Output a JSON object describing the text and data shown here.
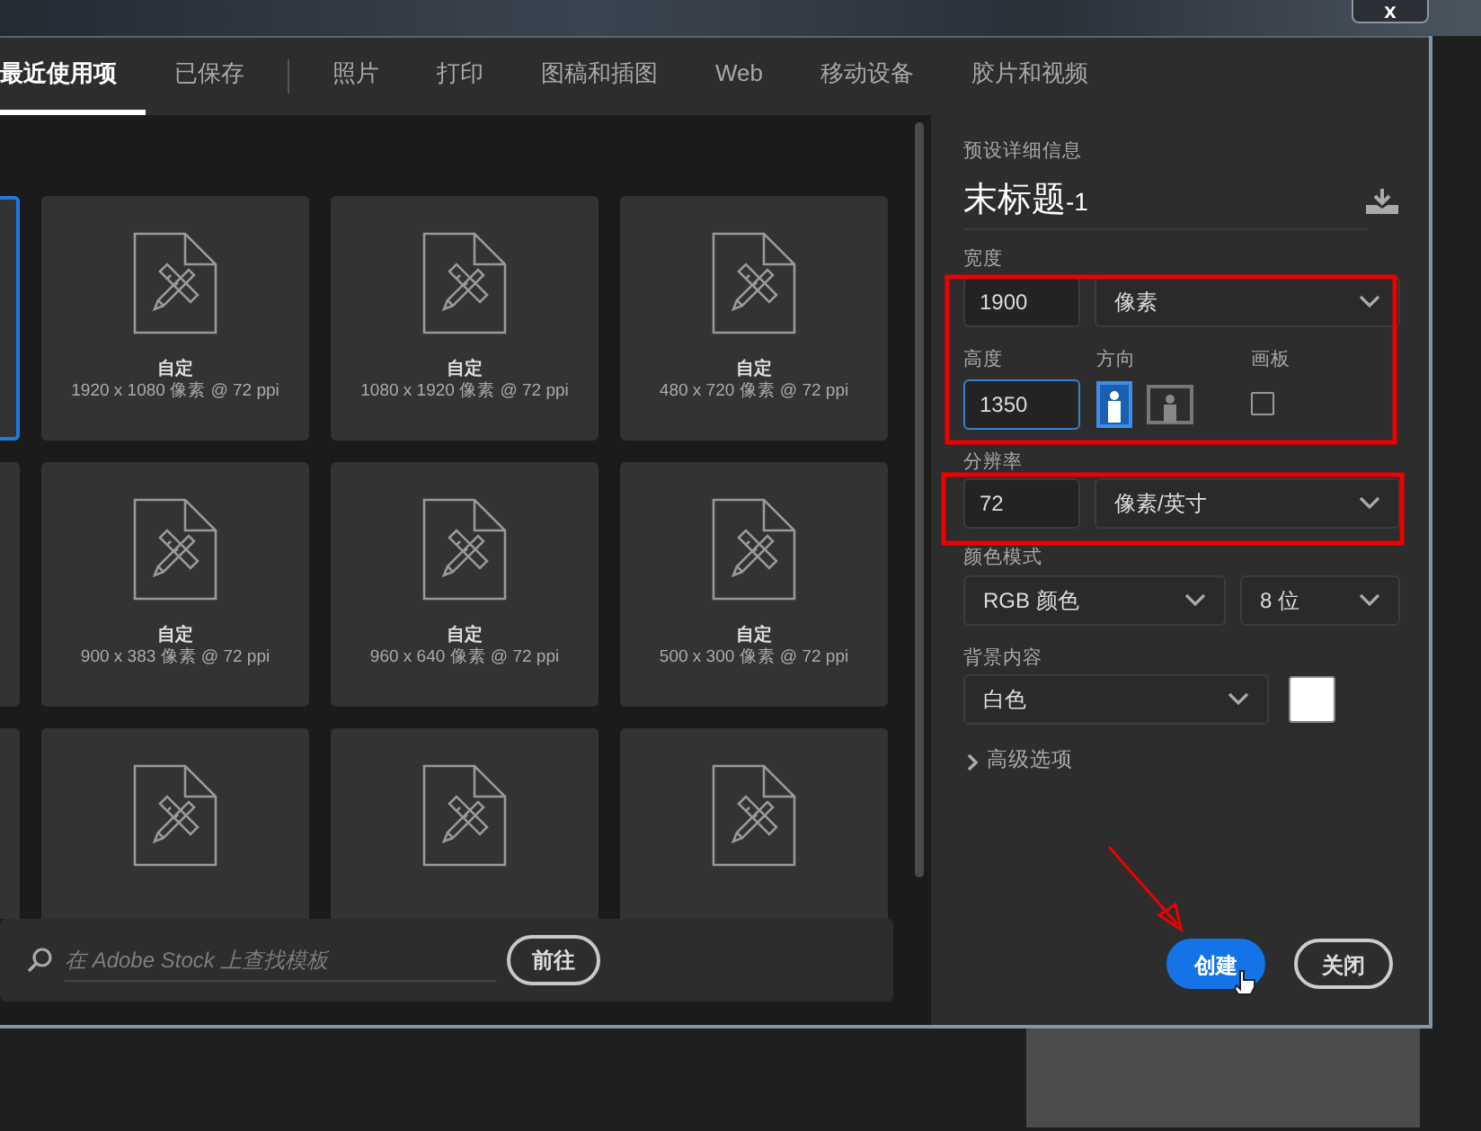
{
  "window": {
    "close_label": "x"
  },
  "tab_groups": [
    [
      {
        "label": "最近使用项",
        "selected": true
      },
      {
        "label": "已保存",
        "selected": false
      }
    ],
    [
      {
        "label": "照片",
        "selected": false
      },
      {
        "label": "打印",
        "selected": false
      },
      {
        "label": "图稿和插图",
        "selected": false
      },
      {
        "label": "Web",
        "selected": false
      },
      {
        "label": "移动设备",
        "selected": false
      },
      {
        "label": "胶片和视频",
        "selected": false
      }
    ]
  ],
  "preset_rows": [
    {
      "edge_card": {
        "selected": true
      },
      "cards": [
        {
          "kind": "full",
          "name": "自定",
          "size": "1920 x 1080 像素 @ 72 ppi"
        },
        {
          "kind": "full",
          "name": "自定",
          "size": "1080 x 1920 像素 @ 72 ppi"
        },
        {
          "kind": "full",
          "name": "自定",
          "size": "480 x 720 像素 @ 72 ppi"
        }
      ]
    },
    {
      "edge_card": {
        "selected": false
      },
      "cards": [
        {
          "kind": "full",
          "name": "自定",
          "size": "900 x 383 像素 @ 72 ppi"
        },
        {
          "kind": "full",
          "name": "自定",
          "size": "960 x 640 像素 @ 72 ppi"
        },
        {
          "kind": "full",
          "name": "自定",
          "size": "500 x 300 像素 @ 72 ppi"
        }
      ]
    },
    {
      "edge_card": {
        "selected": false
      },
      "cards": [
        {
          "kind": "cut"
        },
        {
          "kind": "cut"
        },
        {
          "kind": "cut"
        }
      ]
    }
  ],
  "stock_search": {
    "placeholder": "在 Adobe Stock 上查找模板",
    "button": "前往"
  },
  "details": {
    "heading": "预设详细信息",
    "name": "末标题",
    "name_suffix": "-1",
    "width": {
      "label": "宽度",
      "value": "1900",
      "unit": "像素",
      "focused": false
    },
    "height": {
      "label": "高度",
      "value": "1350",
      "focused": true
    },
    "orientation": {
      "label": "方向",
      "options": [
        {
          "kind": "portrait",
          "selected": true
        },
        {
          "kind": "landscape",
          "selected": false
        }
      ]
    },
    "artboard": {
      "label": "画板",
      "checked": false
    },
    "resolution": {
      "label": "分辨率",
      "value": "72",
      "unit": "像素/英寸",
      "focused": false
    },
    "color_mode": {
      "label": "颜色模式",
      "mode": "RGB 颜色",
      "depth": "8 位"
    },
    "background": {
      "label": "背景内容",
      "value": "白色",
      "color": "#ffffff"
    },
    "advanced": {
      "label": "高级选项",
      "expanded": false
    }
  },
  "buttons": [
    {
      "label": "创建",
      "kind": "primary"
    },
    {
      "label": "关闭",
      "kind": "secondary"
    }
  ]
}
